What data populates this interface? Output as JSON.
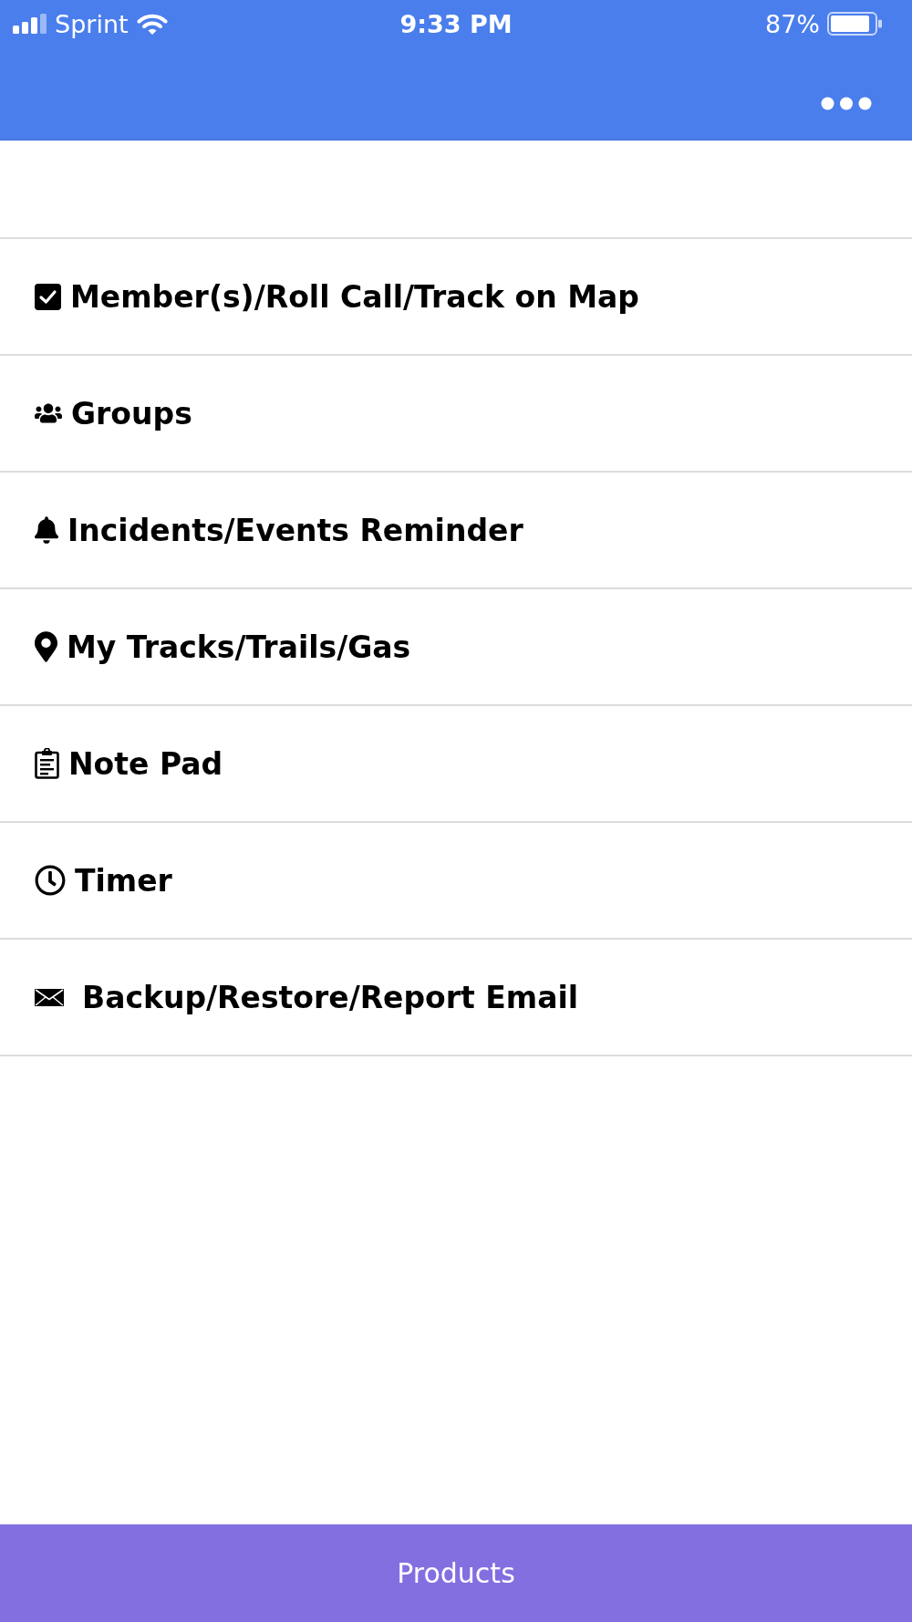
{
  "status_bar": {
    "carrier": "Sprint",
    "time": "9:33 PM",
    "battery": "87%"
  },
  "menu_items": [
    {
      "label": "Member(s)/Roll Call/Track on Map"
    },
    {
      "label": "Groups"
    },
    {
      "label": "Incidents/Events Reminder"
    },
    {
      "label": "My Tracks/Trails/Gas"
    },
    {
      "label": "Note Pad"
    },
    {
      "label": "Timer"
    },
    {
      "label": "Backup/Restore/Report Email"
    }
  ],
  "bottom_bar": {
    "label": "Products"
  }
}
